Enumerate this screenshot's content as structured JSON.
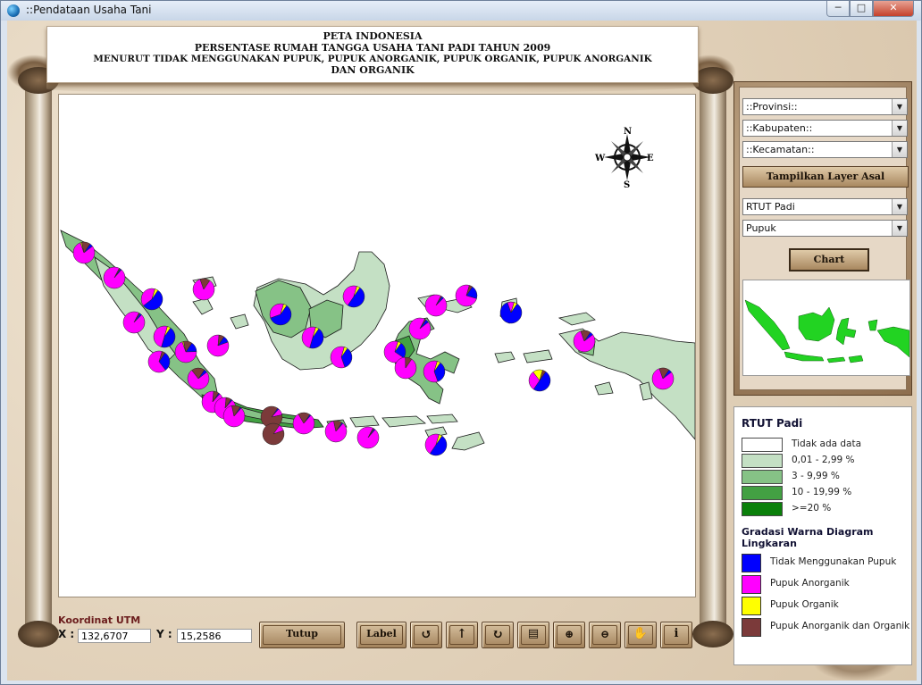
{
  "window": {
    "title": "::Pendataan Usaha Tani",
    "min": "─",
    "max": "□",
    "close": "✕"
  },
  "banner": {
    "line1": "PETA INDONESIA",
    "line2": "PERSENTASE RUMAH TANGGA USAHA TANI PADI TAHUN 2009",
    "line3": "MENURUT TIDAK MENGGUNAKAN PUPUK, PUPUK ANORGANIK, PUPUK ORGANIK, PUPUK ANORGANIK",
    "line4": "DAN ORGANIK"
  },
  "compass": {
    "n": "N",
    "s": "S",
    "e": "E",
    "w": "W"
  },
  "coords": {
    "label": "Koordinat UTM",
    "x_label": "X :",
    "y_label": "Y :",
    "x_value": "132,6707",
    "y_value": "15,2586"
  },
  "toolbar": {
    "close_label": "Tutup",
    "label_label": "Label",
    "icons": [
      "rotate-left-icon",
      "up-arrow-icon",
      "rotate-right-icon",
      "print-icon",
      "zoom-in-icon",
      "zoom-out-icon",
      "hand-pan-icon",
      "info-icon"
    ]
  },
  "filters": {
    "provinsi": "::Provinsi::",
    "kabupaten": "::Kabupaten::",
    "kecamatan": "::Kecamatan::",
    "reset_label": "Tampilkan Layer Asal",
    "indicator": "RTUT Padi",
    "category": "Pupuk",
    "chart_label": "Chart"
  },
  "legend": {
    "title": "RTUT Padi",
    "classes": [
      {
        "label": "Tidak ada data",
        "color": "#ffffff"
      },
      {
        "label": "0,01 - 2,99 %",
        "color": "#c4e0c4"
      },
      {
        "label": "3 - 9,99 %",
        "color": "#86c286"
      },
      {
        "label": "10 - 19,99 %",
        "color": "#43a043"
      },
      {
        "label": ">=20 %",
        "color": "#0a800a"
      }
    ],
    "pie_title": "Gradasi Warna Diagram Lingkaran",
    "pie_classes": [
      {
        "label": "Tidak Menggunakan Pupuk",
        "color": "#0000ff"
      },
      {
        "label": "Pupuk Anorganik",
        "color": "#ff00ff"
      },
      {
        "label": "Pupuk Organik",
        "color": "#ffff00"
      },
      {
        "label": "Pupuk Anorganik dan Organik",
        "color": "#7b3a3a"
      }
    ]
  }
}
